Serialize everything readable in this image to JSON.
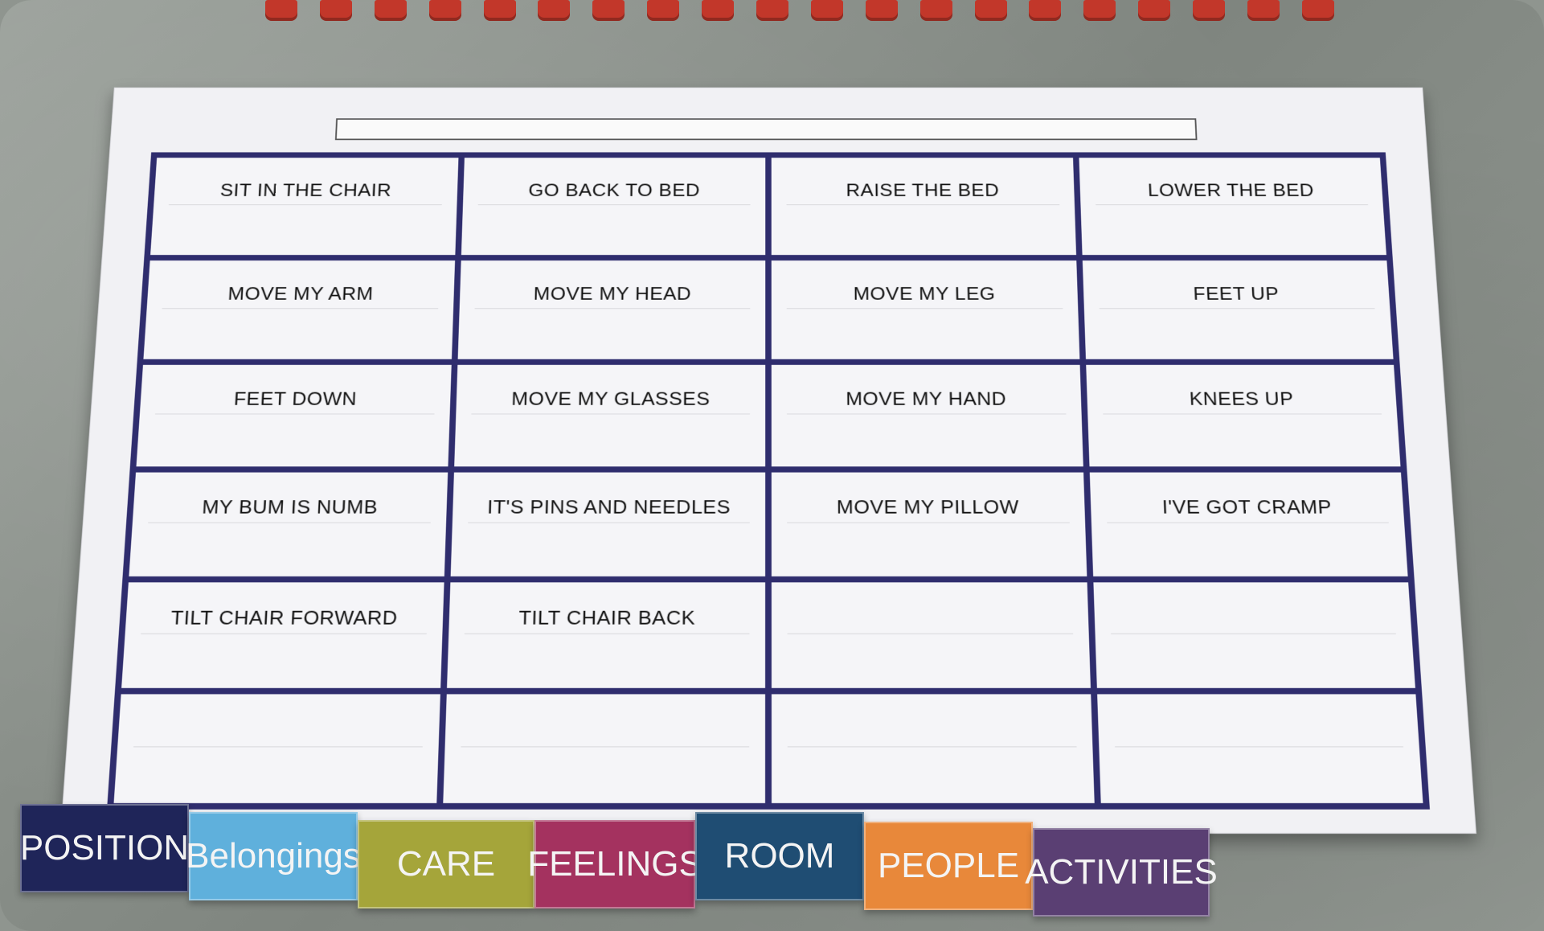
{
  "board": {
    "rows": [
      [
        "SIT IN THE CHAIR",
        "GO BACK TO BED",
        "RAISE THE BED",
        "LOWER THE BED"
      ],
      [
        "MOVE MY ARM",
        "MOVE MY HEAD",
        "MOVE MY LEG",
        "FEET UP"
      ],
      [
        "FEET DOWN",
        "MOVE MY GLASSES",
        "MOVE MY HAND",
        "KNEES UP"
      ],
      [
        "MY BUM IS NUMB",
        "IT'S PINS AND NEEDLES",
        "MOVE MY PILLOW",
        "I'VE GOT CRAMP"
      ],
      [
        "TILT CHAIR FORWARD",
        "TILT CHAIR BACK",
        "",
        ""
      ],
      [
        "",
        "",
        "",
        ""
      ]
    ]
  },
  "tabs": [
    {
      "label": "POSITION",
      "color": "#1f2559"
    },
    {
      "label": "Belongings",
      "color": "#5fb0dc"
    },
    {
      "label": "CARE",
      "color": "#a5a53a"
    },
    {
      "label": "FEELINGS",
      "color": "#a4325f"
    },
    {
      "label": "ROOM",
      "color": "#1f4d73"
    },
    {
      "label": "PEOPLE",
      "color": "#e8883a"
    },
    {
      "label": "ACTIVITIES",
      "color": "#5a3f73"
    }
  ]
}
